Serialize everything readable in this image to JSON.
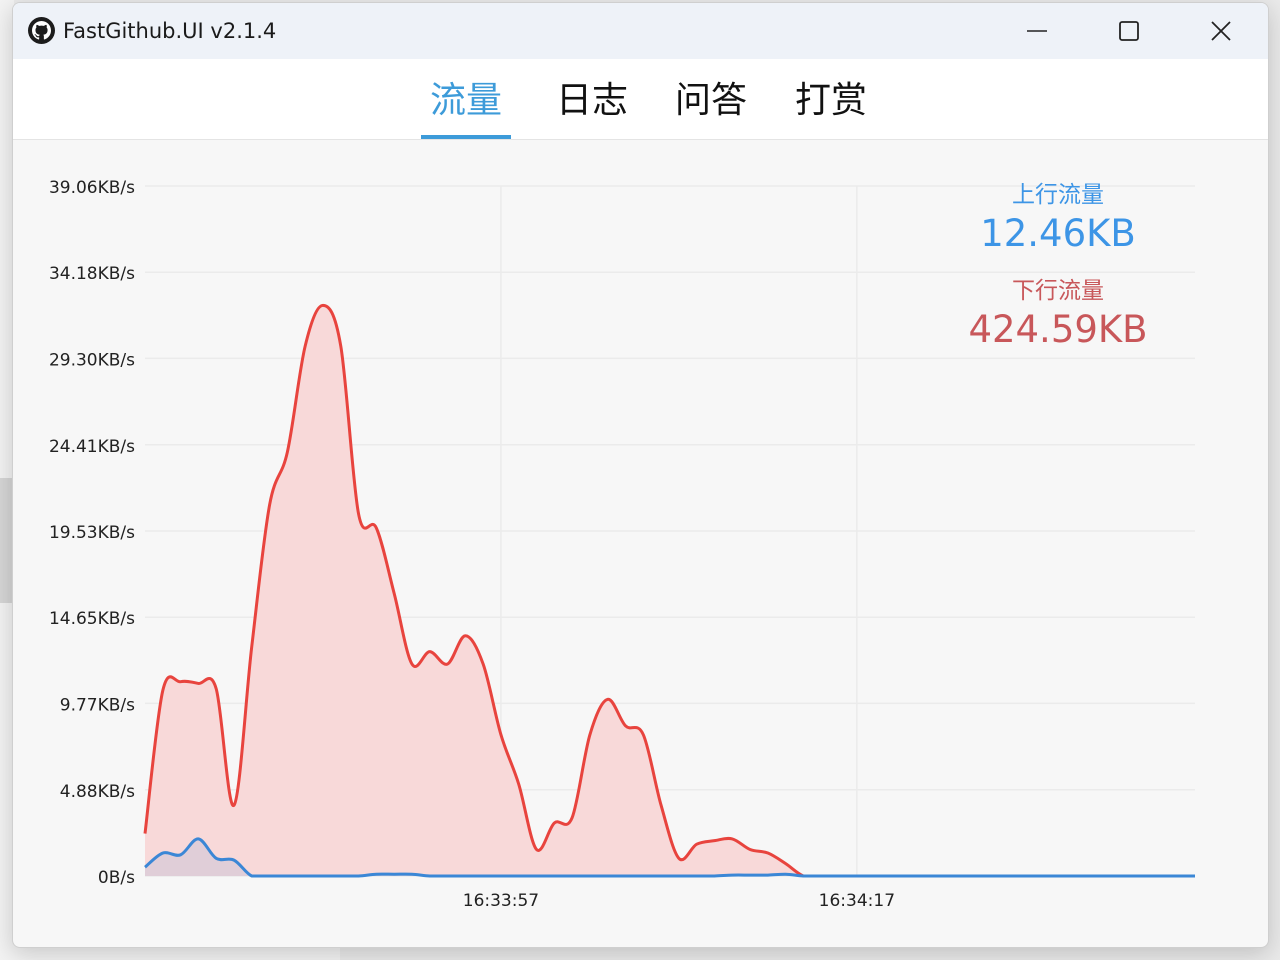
{
  "window": {
    "title": "FastGithub.UI v2.1.4",
    "icon": "github-icon",
    "controls": [
      "minimize-icon",
      "maximize-icon",
      "close-icon"
    ]
  },
  "tabs": [
    {
      "label": "流量",
      "active": true
    },
    {
      "label": "日志",
      "active": false
    },
    {
      "label": "问答",
      "active": false
    },
    {
      "label": "打赏",
      "active": false
    }
  ],
  "stats": {
    "upload_label": "上行流量",
    "upload_value": "12.46KB",
    "download_label": "下行流量",
    "download_value": "424.59KB"
  },
  "colors": {
    "accent": "#3d9bd9",
    "upload": "#3b87d6",
    "download": "#e8443e",
    "download_fill": "#f8d9d9",
    "upload_stat": "#3d95e6",
    "download_stat": "#c8575a"
  },
  "chart_data": {
    "type": "area",
    "y_tick_labels": [
      "0B/s",
      "4.88KB/s",
      "9.77KB/s",
      "14.65KB/s",
      "19.53KB/s",
      "24.41KB/s",
      "29.30KB/s",
      "34.18KB/s",
      "39.06KB/s"
    ],
    "y_ticks": [
      0,
      4.88,
      9.77,
      14.65,
      19.53,
      24.41,
      29.3,
      34.18,
      39.06
    ],
    "ylim": [
      0,
      39.06
    ],
    "x_tick_labels": [
      "16:33:57",
      "16:34:17"
    ],
    "grid": true,
    "series": [
      {
        "role": "download",
        "x": [
          0,
          0.5,
          1,
          1.5,
          2,
          2.5,
          3,
          3.5,
          4,
          4.5,
          5,
          5.5,
          6,
          6.5,
          7,
          7.5,
          8,
          8.5,
          9,
          9.5,
          10,
          10.5,
          11,
          11.5,
          12,
          12.5,
          13,
          13.5,
          14,
          14.5,
          15,
          15.5,
          16,
          16.5,
          17,
          17.5,
          18,
          18.5,
          19,
          19.5,
          20,
          20.5,
          21,
          21.5,
          22,
          22.5,
          23,
          23.5,
          24,
          24.5,
          25,
          25.5,
          26,
          26.5,
          27,
          27.5,
          28,
          28.5,
          29,
          29.5
        ],
        "values": [
          2.4,
          10.5,
          11.0,
          10.9,
          10.6,
          4.0,
          13.0,
          21.0,
          24.0,
          30.0,
          32.3,
          30.0,
          20.5,
          19.7,
          16.0,
          12.0,
          12.7,
          12.0,
          13.6,
          12.0,
          8.0,
          5.2,
          1.5,
          3.0,
          3.3,
          8.0,
          10.0,
          8.5,
          8.0,
          4.0,
          1.0,
          1.8,
          2.0,
          2.1,
          1.5,
          1.3,
          0.7,
          0.0,
          0.0,
          0.0,
          0.0,
          0.0,
          0.0,
          0.0,
          0.0,
          0.0,
          0.0,
          0.0,
          0.0,
          0.0,
          0.0,
          0.0,
          0.0,
          0.0,
          0.0,
          0.0,
          0.0,
          0.0,
          0.0,
          0.0
        ]
      },
      {
        "role": "upload",
        "x": [
          0,
          0.5,
          1,
          1.5,
          2,
          2.5,
          3,
          3.5,
          4,
          4.5,
          5,
          5.5,
          6,
          6.5,
          7,
          7.5,
          8,
          8.5,
          9,
          9.5,
          10,
          10.5,
          11,
          11.5,
          12,
          12.5,
          13,
          13.5,
          14,
          14.5,
          15,
          15.5,
          16,
          16.5,
          17,
          17.5,
          18,
          18.5,
          19,
          19.5,
          20,
          20.5,
          21,
          21.5,
          22,
          22.5,
          23,
          23.5,
          24,
          24.5,
          25,
          25.5,
          26,
          26.5,
          27,
          27.5,
          28,
          28.5,
          29,
          29.5
        ],
        "values": [
          0.5,
          1.3,
          1.2,
          2.1,
          1.0,
          0.9,
          0.0,
          0.0,
          0.0,
          0.0,
          0.0,
          0.0,
          0.0,
          0.1,
          0.1,
          0.1,
          0.0,
          0.0,
          0.0,
          0.0,
          0.0,
          0.0,
          0.0,
          0.0,
          0.0,
          0.0,
          0.0,
          0.0,
          0.0,
          0.0,
          0.0,
          0.0,
          0.0,
          0.05,
          0.05,
          0.05,
          0.1,
          0.0,
          0.0,
          0.0,
          0.0,
          0.0,
          0.0,
          0.0,
          0.0,
          0.0,
          0.0,
          0.0,
          0.0,
          0.0,
          0.0,
          0.0,
          0.0,
          0.0,
          0.0,
          0.0,
          0.0,
          0.0,
          0.0,
          0.0
        ]
      }
    ],
    "x_tick_positions": [
      10,
      20
    ]
  }
}
